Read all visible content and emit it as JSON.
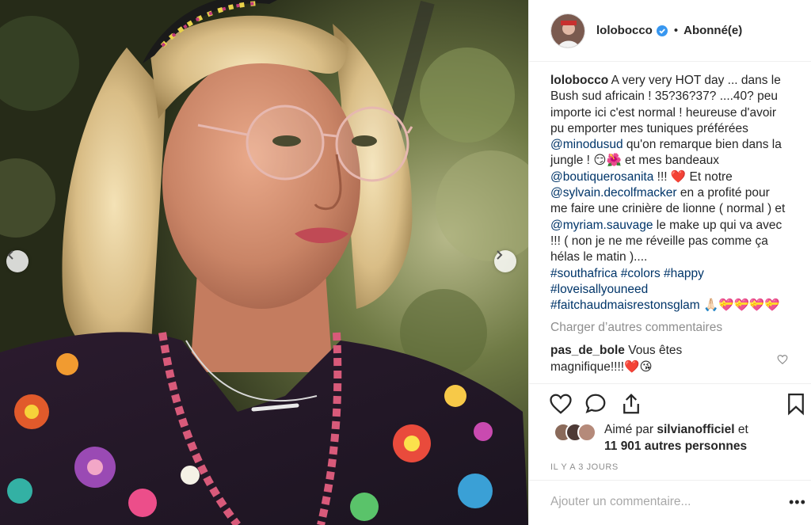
{
  "post": {
    "username": "lolobocco",
    "follow_status": "Abonné(e)",
    "dot": "•"
  },
  "caption": {
    "username": "lolobocco",
    "text_1": " A very very HOT day ... dans le Bush sud africain ! 35?36?37? ....40? peu importe ici c'est normal ! heureuse d'avoir pu emporter mes tuniques préférées ",
    "mention_1": "@minodusud",
    "text_2": " qu'on remarque bien dans la jungle ! 😏🌺 et mes bandeaux ",
    "mention_2": "@boutiquerosanita",
    "text_3": " !!! ❤️ Et notre ",
    "mention_3": "@sylvain.decolfmacker",
    "text_4": " en a profité pour me faire une crinière de lionne ( normal ) et ",
    "mention_4": "@myriam.sauvage",
    "text_5": " le make up qui va avec !!! ( non je ne me réveille pas comme ça hélas le matin )....",
    "hashtag_1": "#southafrica",
    "hashtag_2": "#colors",
    "hashtag_3": "#happy",
    "hashtag_4": "#loveisallyouneed",
    "hashtag_5": "#faitchaudmaisrestonsglam",
    "emoji_tail": " 🙏🏻💝💝💝💝"
  },
  "load_more": "Charger d’autres commentaires",
  "comment": {
    "username": "pas_de_bole",
    "text": " Vous êtes magnifique!!!!❤️😘"
  },
  "likes": {
    "prefix": "Aimé par ",
    "liker": "silvianofficiel",
    "middle": " et",
    "count": "11 901 autres personnes"
  },
  "timestamp": "Il y a 3 jours",
  "add_comment": {
    "placeholder": "Ajouter un commentaire..."
  },
  "more_label": "•••",
  "icons": {
    "prev": "chevron-left-icon",
    "next": "chevron-right-icon",
    "like": "heart-icon",
    "comment": "speech-bubble-icon",
    "share": "share-icon",
    "save": "bookmark-icon",
    "verified": "verified-badge-icon"
  },
  "colors": {
    "text": "#262626",
    "muted": "#8e8e8e",
    "link": "#003569",
    "verified": "#3897f0",
    "divider": "#efefef"
  }
}
